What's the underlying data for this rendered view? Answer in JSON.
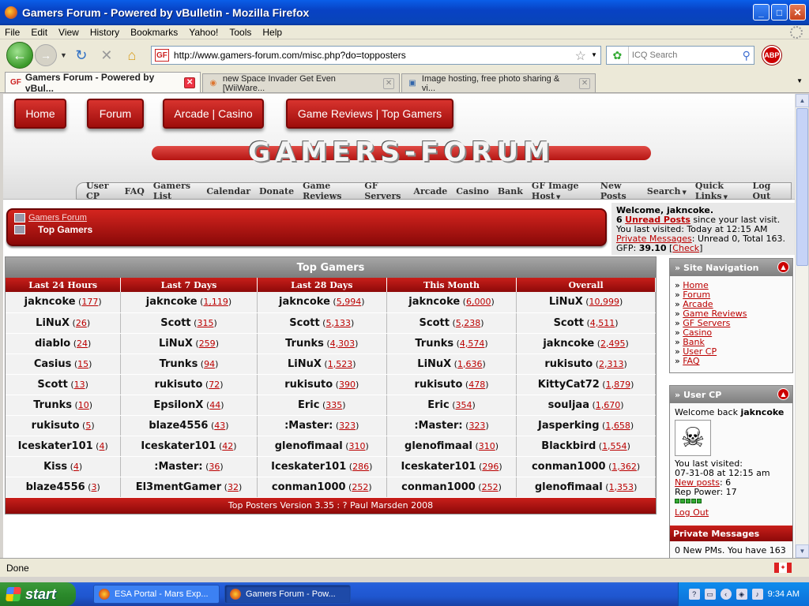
{
  "window": {
    "title": "Gamers Forum - Powered by vBulletin - Mozilla Firefox"
  },
  "menu": [
    "File",
    "Edit",
    "View",
    "History",
    "Bookmarks",
    "Yahoo!",
    "Tools",
    "Help"
  ],
  "nav": {
    "url": "http://www.gamers-forum.com/misc.php?do=topposters",
    "search_placeholder": "ICQ Search",
    "abp_label": "ABP"
  },
  "tabs": [
    {
      "label": "Gamers Forum - Powered by vBul..."
    },
    {
      "label": "new Space Invader Get Even [WiiWare..."
    },
    {
      "label": "Image hosting, free photo sharing & vi..."
    }
  ],
  "site": {
    "top_nav": [
      "Home",
      "Forum",
      "Arcade | Casino",
      "Game Reviews | Top Gamers"
    ],
    "logo": "GAMERS-FORUM",
    "sub_nav": [
      "User CP",
      "FAQ",
      "Gamers List",
      "Calendar",
      "Donate",
      "Game Reviews",
      "GF Servers",
      "Arcade",
      "Casino",
      "Bank",
      "GF Image Host",
      "New Posts",
      "Search",
      "Quick Links",
      "Log Out"
    ],
    "breadcrumb": {
      "parent": "Gamers Forum",
      "current": "Top Gamers"
    },
    "welcome": {
      "greeting": "Welcome, jakncoke.",
      "unread_count": "6",
      "unread_label": "Unread Posts",
      "unread_suffix": "since your last visit.",
      "last_visited": "You last visited: Today at 12:15 AM",
      "pm_label": "Private Messages",
      "pm_stats": ": Unread 0, Total 163.",
      "gfp_label": "GFP:",
      "gfp_value": "39.10",
      "check_label": "Check"
    }
  },
  "top_gamers": {
    "title": "Top Gamers",
    "columns": [
      "Last 24 Hours",
      "Last 7 Days",
      "Last 28 Days",
      "This Month",
      "Overall"
    ],
    "rows": [
      [
        [
          "jakncoke",
          "177"
        ],
        [
          "jakncoke",
          "1,119"
        ],
        [
          "jakncoke",
          "5,994"
        ],
        [
          "jakncoke",
          "6,000"
        ],
        [
          "LiNuX",
          "10,999"
        ]
      ],
      [
        [
          "LiNuX",
          "26"
        ],
        [
          "Scott",
          "315"
        ],
        [
          "Scott",
          "5,133"
        ],
        [
          "Scott",
          "5,238"
        ],
        [
          "Scott",
          "4,511"
        ]
      ],
      [
        [
          "diablo",
          "24"
        ],
        [
          "LiNuX",
          "259"
        ],
        [
          "Trunks",
          "4,303"
        ],
        [
          "Trunks",
          "4,574"
        ],
        [
          "jakncoke",
          "2,495"
        ]
      ],
      [
        [
          "Casius",
          "15"
        ],
        [
          "Trunks",
          "94"
        ],
        [
          "LiNuX",
          "1,523"
        ],
        [
          "LiNuX",
          "1,636"
        ],
        [
          "rukisuto",
          "2,313"
        ]
      ],
      [
        [
          "Scott",
          "13"
        ],
        [
          "rukisuto",
          "72"
        ],
        [
          "rukisuto",
          "390"
        ],
        [
          "rukisuto",
          "478"
        ],
        [
          "KittyCat72",
          "1,879"
        ]
      ],
      [
        [
          "Trunks",
          "10"
        ],
        [
          "EpsilonX",
          "44"
        ],
        [
          "Eric",
          "335"
        ],
        [
          "Eric",
          "354"
        ],
        [
          "souljaa",
          "1,670"
        ]
      ],
      [
        [
          "rukisuto",
          "5"
        ],
        [
          "blaze4556",
          "43"
        ],
        [
          ":Master:",
          "323"
        ],
        [
          ":Master:",
          "323"
        ],
        [
          "Jasperking",
          "1,658"
        ]
      ],
      [
        [
          "Iceskater101",
          "4"
        ],
        [
          "Iceskater101",
          "42"
        ],
        [
          "glenofimaal",
          "310"
        ],
        [
          "glenofimaal",
          "310"
        ],
        [
          "Blackbird",
          "1,554"
        ]
      ],
      [
        [
          "Kiss",
          "4"
        ],
        [
          ":Master:",
          "36"
        ],
        [
          "Iceskater101",
          "286"
        ],
        [
          "Iceskater101",
          "296"
        ],
        [
          "conman1000",
          "1,362"
        ]
      ],
      [
        [
          "blaze4556",
          "3"
        ],
        [
          "El3mentGamer",
          "32"
        ],
        [
          "conman1000",
          "252"
        ],
        [
          "conman1000",
          "252"
        ],
        [
          "glenofimaal",
          "1,353"
        ]
      ]
    ],
    "footer": "Top Posters Version 3.35 : ? Paul Marsden 2008"
  },
  "site_nav": {
    "title": "Site Navigation",
    "items": [
      "Home",
      "Forum",
      "Arcade",
      "Game Reviews",
      "GF Servers",
      "Casino",
      "Bank",
      "User CP",
      "FAQ"
    ]
  },
  "user_cp": {
    "title": "User CP",
    "welcome_prefix": "Welcome back",
    "username": "jakncoke",
    "last_visited_label": "You last visited:",
    "last_visited_value": "07-31-08 at 12:15 am",
    "new_posts_label": "New posts",
    "new_posts_value": ": 6",
    "rep_power": "Rep Power: 17",
    "rep_level": 5,
    "logout": "Log Out"
  },
  "pm": {
    "title": "Private Messages",
    "text": "0 New PMs. You have 163"
  },
  "status": {
    "text": "Done"
  },
  "taskbar": {
    "start": "start",
    "tasks": [
      "ESA Portal - Mars Exp...",
      "Gamers Forum - Pow..."
    ],
    "clock": "9:34 AM"
  }
}
